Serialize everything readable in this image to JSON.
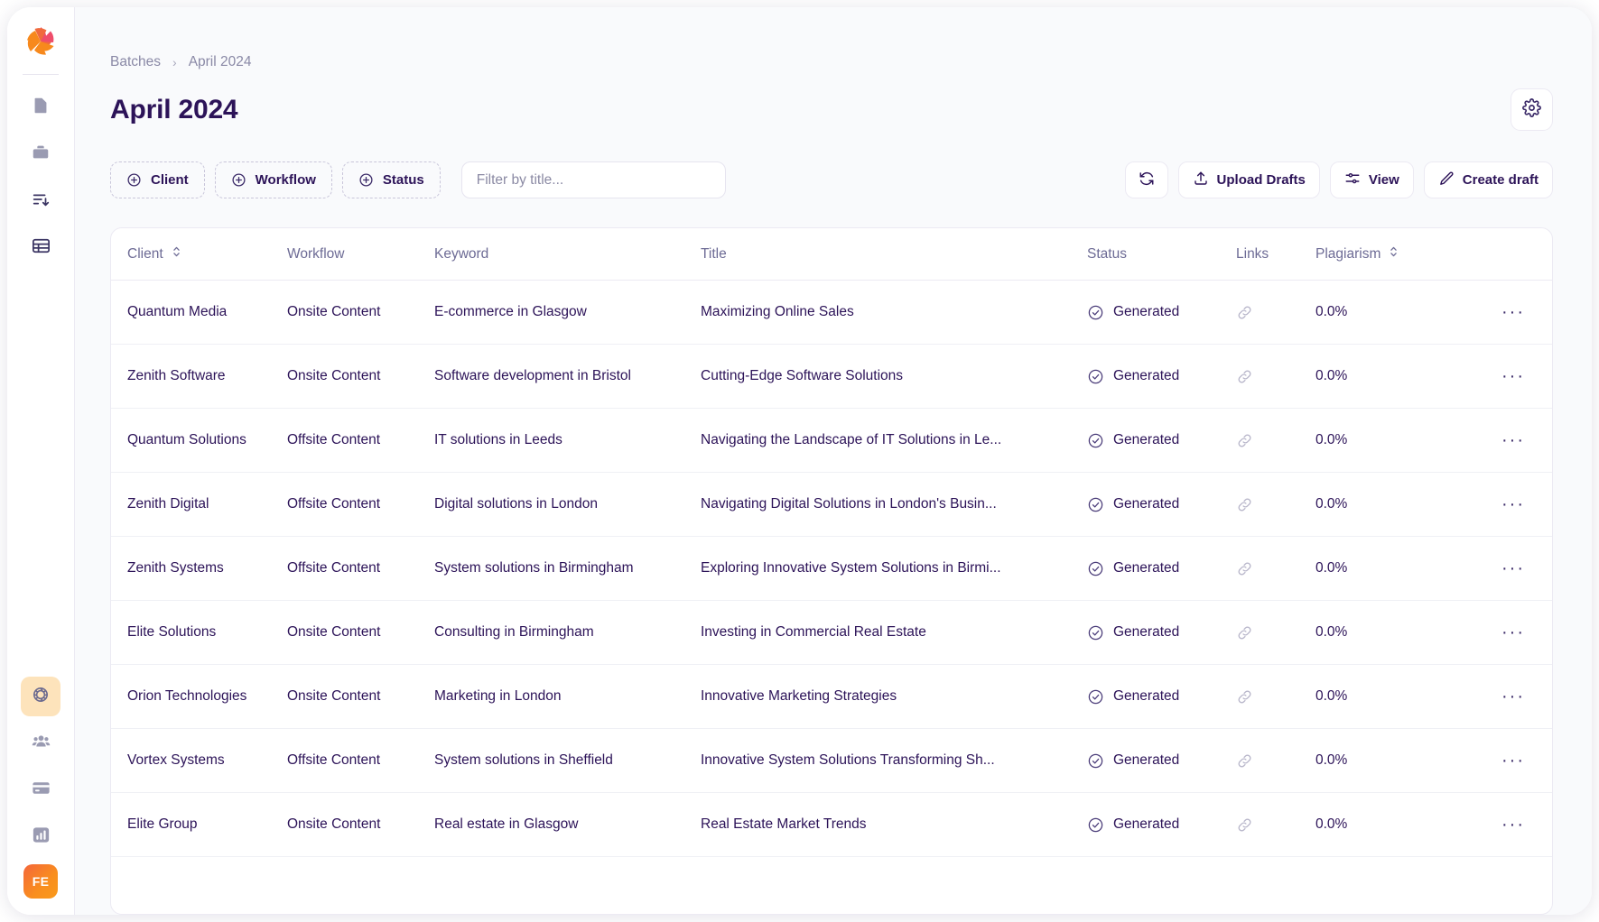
{
  "sidebar": {
    "logo_name": "app-logo",
    "items": [
      {
        "name": "sidebar-item-documents",
        "icon": "document-icon",
        "state": "default"
      },
      {
        "name": "sidebar-item-briefcase",
        "icon": "briefcase-icon",
        "state": "default"
      },
      {
        "name": "sidebar-item-queue",
        "icon": "sort-down-icon",
        "state": "default"
      },
      {
        "name": "sidebar-item-batches",
        "icon": "table-icon",
        "state": "dark"
      }
    ],
    "bottom_items": [
      {
        "name": "sidebar-item-integrations",
        "icon": "circle-loop-icon",
        "state": "active"
      },
      {
        "name": "sidebar-item-team",
        "icon": "users-icon",
        "state": "default"
      },
      {
        "name": "sidebar-item-billing",
        "icon": "credit-card-icon",
        "state": "default"
      },
      {
        "name": "sidebar-item-reports",
        "icon": "bar-chart-icon",
        "state": "default"
      }
    ],
    "avatar_initials": "FE"
  },
  "breadcrumb": {
    "root": "Batches",
    "separator": "›",
    "current": "April 2024"
  },
  "header": {
    "title": "April 2024",
    "settings_icon": "gear-icon"
  },
  "toolbar": {
    "filters": [
      {
        "label": "Client",
        "icon": "plus-circle-icon"
      },
      {
        "label": "Workflow",
        "icon": "plus-circle-icon"
      },
      {
        "label": "Status",
        "icon": "plus-circle-icon"
      }
    ],
    "search": {
      "value": "",
      "placeholder": "Filter by title..."
    },
    "actions": [
      {
        "label": "",
        "icon": "refresh-icon",
        "name": "refresh-button"
      },
      {
        "label": "Upload Drafts",
        "icon": "upload-icon",
        "name": "upload-drafts-button"
      },
      {
        "label": "View",
        "icon": "sliders-icon",
        "name": "view-button"
      },
      {
        "label": "Create draft",
        "icon": "pencil-icon",
        "name": "create-draft-button"
      }
    ]
  },
  "table": {
    "columns": [
      {
        "label": "Client",
        "sortable": true
      },
      {
        "label": "Workflow",
        "sortable": false
      },
      {
        "label": "Keyword",
        "sortable": false
      },
      {
        "label": "Title",
        "sortable": false
      },
      {
        "label": "Status",
        "sortable": false
      },
      {
        "label": "Links",
        "sortable": false
      },
      {
        "label": "Plagiarism",
        "sortable": true
      },
      {
        "label": "",
        "sortable": false
      }
    ],
    "rows": [
      {
        "client": "Quantum Media",
        "workflow": "Onsite Content",
        "keyword": "E-commerce in Glasgow",
        "title": "Maximizing Online Sales",
        "status": "Generated",
        "links": "link-icon",
        "plagiarism": "0.0%",
        "actions": "···"
      },
      {
        "client": "Zenith Software",
        "workflow": "Onsite Content",
        "keyword": "Software development in Bristol",
        "title": "Cutting-Edge Software Solutions",
        "status": "Generated",
        "links": "link-icon",
        "plagiarism": "0.0%",
        "actions": "···"
      },
      {
        "client": "Quantum Solutions",
        "workflow": "Offsite Content",
        "keyword": "IT solutions in Leeds",
        "title": "Navigating the Landscape of IT Solutions in Le...",
        "status": "Generated",
        "links": "link-icon",
        "plagiarism": "0.0%",
        "actions": "···"
      },
      {
        "client": "Zenith Digital",
        "workflow": "Offsite Content",
        "keyword": "Digital solutions in London",
        "title": "Navigating Digital Solutions in London's Busin...",
        "status": "Generated",
        "links": "link-icon",
        "plagiarism": "0.0%",
        "actions": "···"
      },
      {
        "client": "Zenith Systems",
        "workflow": "Offsite Content",
        "keyword": "System solutions in Birmingham",
        "title": "Exploring Innovative System Solutions in Birmi...",
        "status": "Generated",
        "links": "link-icon",
        "plagiarism": "0.0%",
        "actions": "···"
      },
      {
        "client": "Elite Solutions",
        "workflow": "Onsite Content",
        "keyword": "Consulting in Birmingham",
        "title": "Investing in Commercial Real Estate",
        "status": "Generated",
        "links": "link-icon",
        "plagiarism": "0.0%",
        "actions": "···"
      },
      {
        "client": "Orion Technologies",
        "workflow": "Onsite Content",
        "keyword": "Marketing in London",
        "title": "Innovative Marketing Strategies",
        "status": "Generated",
        "links": "link-icon",
        "plagiarism": "0.0%",
        "actions": "···"
      },
      {
        "client": "Vortex Systems",
        "workflow": "Offsite Content",
        "keyword": "System solutions in Sheffield",
        "title": "Innovative System Solutions Transforming Sh...",
        "status": "Generated",
        "links": "link-icon",
        "plagiarism": "0.0%",
        "actions": "···"
      },
      {
        "client": "Elite Group",
        "workflow": "Onsite Content",
        "keyword": "Real estate in Glasgow",
        "title": "Real Estate Market Trends",
        "status": "Generated",
        "links": "link-icon",
        "plagiarism": "0.0%",
        "actions": "···"
      }
    ]
  },
  "colors": {
    "accent_orange": "#f7891d",
    "accent_pink": "#ef4d6b",
    "text_primary": "#2c1358",
    "text_muted": "#6d6b95",
    "page_bg": "#f9fafc",
    "active_pill": "#fde3bb"
  }
}
